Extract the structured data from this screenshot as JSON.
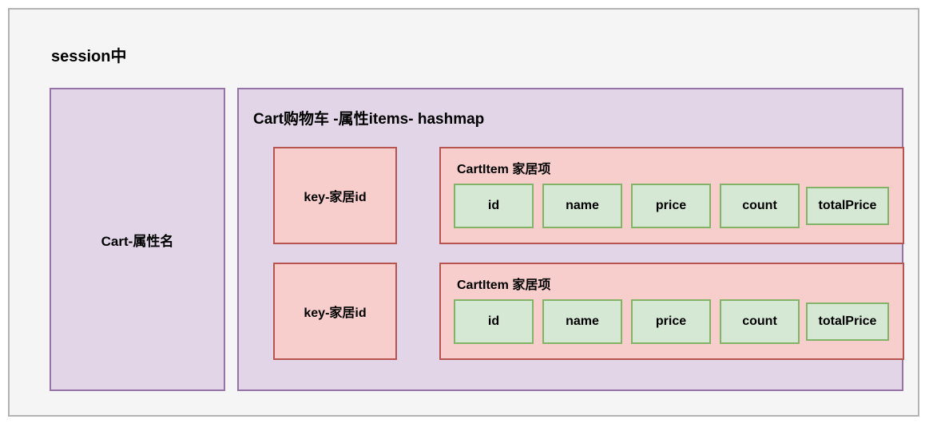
{
  "session": {
    "title": "session中",
    "frame_bg": "#f5f5f5",
    "frame_border": "#b3b3b3"
  },
  "attribute_box": {
    "label": "Cart-属性名",
    "fill": "#e1d5e7",
    "stroke": "#9673a6"
  },
  "cart": {
    "title": "Cart购物车 -属性items- hashmap",
    "fill": "#e1d5e7",
    "stroke": "#9673a6",
    "entries": [
      {
        "key_label": "key-家居id",
        "item_title": "CartItem 家居项",
        "fields": [
          "id",
          "name",
          "price",
          "count",
          "totalPrice"
        ]
      },
      {
        "key_label": "key-家居id",
        "item_title": "CartItem 家居项",
        "fields": [
          "id",
          "name",
          "price",
          "count",
          "totalPrice"
        ]
      }
    ],
    "entry_fill": "#f8cecc",
    "entry_stroke": "#b85450",
    "field_fill": "#d5e8d4",
    "field_stroke": "#82b366"
  }
}
